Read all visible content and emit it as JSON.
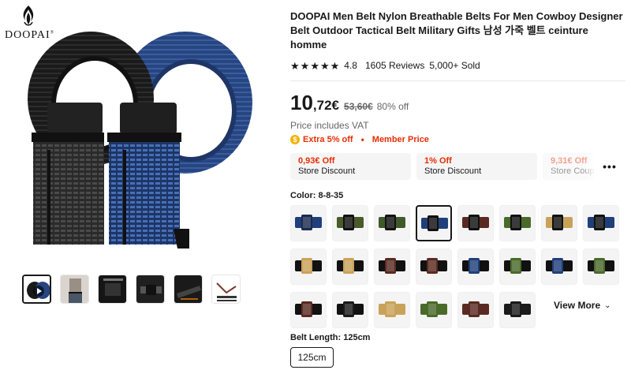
{
  "brand": {
    "name": "DOOPAI",
    "registered_mark": "®"
  },
  "product": {
    "title": "DOOPAI Men Belt Nylon Breathable Belts For Men Cowboy Designer Belt Outdoor Tactical Belt Military Gifts 남성 가죽 벨트 ceinture homme",
    "rating": "4.8",
    "stars": 5,
    "reviews": "1605 Reviews",
    "sold": "5,000+ Sold"
  },
  "price": {
    "integer": "10",
    "decimal": ",72€",
    "original": "53,60€",
    "discount": "80% off",
    "vat_note": "Price includes VAT"
  },
  "promo": {
    "extra": "Extra 5% off",
    "separator": "•",
    "member": "Member Price"
  },
  "coupons": [
    {
      "amount": "0,93€ Off",
      "label": "Store Discount"
    },
    {
      "amount": "1% Off",
      "label": "Store Discount"
    },
    {
      "amount": "9,31€ Off",
      "label": "Store Coupon"
    }
  ],
  "coupons_more": "•••",
  "color": {
    "label": "Color: 8-8-35",
    "selected_index": 3,
    "swatches": [
      {
        "strap": "#1f3f7a",
        "buckle": "#1b2b4f"
      },
      {
        "strap": "#4a5a2a",
        "buckle": "#111111"
      },
      {
        "strap": "#3f5a2a",
        "buckle": "#111111"
      },
      {
        "strap": "#1f3f7a",
        "buckle": "#111111"
      },
      {
        "strap": "#5a2a22",
        "buckle": "#111111"
      },
      {
        "strap": "#4a6a2a",
        "buckle": "#111111"
      },
      {
        "strap": "#c9a25a",
        "buckle": "#111111"
      },
      {
        "strap": "#1f3f7a",
        "buckle": "#111111"
      },
      {
        "strap": "#111111",
        "buckle": "#c9a25a"
      },
      {
        "strap": "#111111",
        "buckle": "#c9a25a"
      },
      {
        "strap": "#111111",
        "buckle": "#5a2a22"
      },
      {
        "strap": "#111111",
        "buckle": "#5a2a22"
      },
      {
        "strap": "#111111",
        "buckle": "#1f3f7a"
      },
      {
        "strap": "#111111",
        "buckle": "#4a6a2a"
      },
      {
        "strap": "#111111",
        "buckle": "#1f3f7a"
      },
      {
        "strap": "#111111",
        "buckle": "#4a6a2a"
      },
      {
        "strap": "#111111",
        "buckle": "#5a2a22"
      },
      {
        "strap": "#111111",
        "buckle": "#1a1a1a"
      },
      {
        "strap": "#c9a25a",
        "buckle": "#c9a25a"
      },
      {
        "strap": "#4a6a2a",
        "buckle": "#4a6a2a"
      },
      {
        "strap": "#5a2a22",
        "buckle": "#5a2a22"
      },
      {
        "strap": "#1a1a1a",
        "buckle": "#1a1a1a"
      }
    ]
  },
  "view_more": "View More",
  "length": {
    "label": "Belt Length: 125cm",
    "options": [
      "125cm"
    ]
  },
  "colors": {
    "accent": "#e62e04",
    "text": "#191919",
    "muted": "#666666",
    "coin": "#f5b100"
  },
  "icons": {
    "star": "star-icon",
    "coin": "coin-icon",
    "chevron": "chevron-down-icon",
    "play": "play-icon",
    "logo": "flame-logo-icon"
  }
}
